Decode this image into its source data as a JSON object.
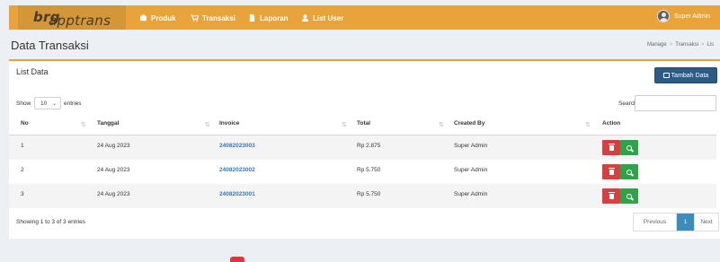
{
  "app": {
    "brand_prefix": "apptrans",
    "brand_suffix": "brg"
  },
  "nav": [
    {
      "label": "Produk",
      "icon": "cube-icon"
    },
    {
      "label": "Transaksi",
      "icon": "cart-icon"
    },
    {
      "label": "Laporan",
      "icon": "document-icon"
    },
    {
      "label": "List User",
      "icon": "user-icon"
    }
  ],
  "user": {
    "name": "Super Admin"
  },
  "page": {
    "title": "Data Transaksi",
    "breadcrumb": [
      "Manage",
      "Transaksi",
      "Lis"
    ]
  },
  "box": {
    "title": "List Data",
    "add_button": "Tambah Data"
  },
  "controls": {
    "show_label": "Show",
    "entries_value": "10",
    "entries_label": "entries",
    "search_label": "Search:",
    "search_value": ""
  },
  "table": {
    "headers": [
      "No",
      "Tanggal",
      "Invoice",
      "Total",
      "Created By",
      "Action"
    ],
    "rows": [
      {
        "no": "1",
        "tanggal": "24 Aug 2023",
        "invoice": "24082023003",
        "total": "Rp 2.875",
        "created_by": "Super Admin"
      },
      {
        "no": "2",
        "tanggal": "24 Aug 2023",
        "invoice": "24082023002",
        "total": "Rp 5.750",
        "created_by": "Super Admin"
      },
      {
        "no": "3",
        "tanggal": "24 Aug 2023",
        "invoice": "24082023001",
        "total": "Rp 5.750",
        "created_by": "Super Admin"
      }
    ]
  },
  "footer": {
    "info": "Showing 1 to 3 of 3 entries",
    "prev": "Previous",
    "page": "1",
    "next": "Next"
  },
  "colors": {
    "header": "#e8a33a",
    "primary": "#2d5b85",
    "danger": "#d64040",
    "success": "#2fa24a",
    "link": "#3c76b0"
  }
}
